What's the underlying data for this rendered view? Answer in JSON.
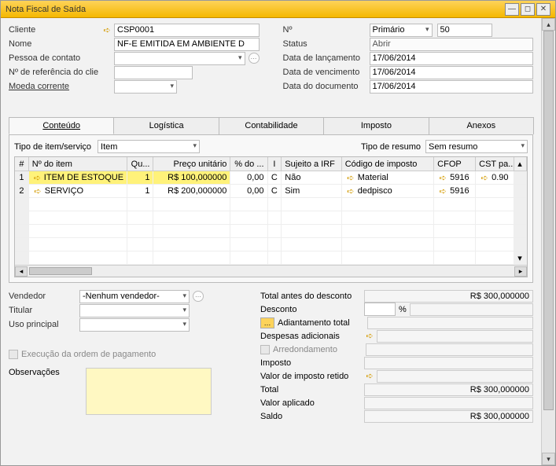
{
  "window": {
    "title": "Nota Fiscal de Saída"
  },
  "left": {
    "cliente_label": "Cliente",
    "cliente_value": "CSP0001",
    "nome_label": "Nome",
    "nome_value": "NF-E EMITIDA EM AMBIENTE D",
    "contato_label": "Pessoa de contato",
    "contato_value": "",
    "ref_label": "Nº de referência do clie",
    "ref_value": "",
    "moeda_label": "Moeda corrente",
    "moeda_value": ""
  },
  "rightf": {
    "no_label": "Nº",
    "no_type": "Primário",
    "no_value": "50",
    "status_label": "Status",
    "status_value": "Abrir",
    "lanc_label": "Data de lançamento",
    "lanc_value": "17/06/2014",
    "venc_label": "Data de vencimento",
    "venc_value": "17/06/2014",
    "doc_label": "Data do documento",
    "doc_value": "17/06/2014"
  },
  "tabs": {
    "t0": "Conteúdo",
    "t1": "Logística",
    "t2": "Contabilidade",
    "t3": "Imposto",
    "t4": "Anexos"
  },
  "sub": {
    "tipo_label": "Tipo de item/serviço",
    "tipo_value": "Item",
    "resumo_label": "Tipo de resumo",
    "resumo_value": "Sem resumo"
  },
  "grid": {
    "h0": "#",
    "h1": "Nº do item",
    "h2": "Qu...",
    "h3": "Preço unitário",
    "h4": "% do ...",
    "h5": "I",
    "h6": "Sujeito a IRF",
    "h7": "Código de imposto",
    "h8": "CFOP",
    "h9": "CST pa...",
    "rows": [
      {
        "n": "1",
        "item": "ITEM DE ESTOQUE",
        "q": "1",
        "price": "R$ 100,000000",
        "pct": "0,00",
        "i": "C",
        "irf": "Não",
        "tax": "Material",
        "cfop": "5916",
        "cst": "0.90"
      },
      {
        "n": "2",
        "item": "SERVIÇO",
        "q": "1",
        "price": "R$ 200,000000",
        "pct": "0,00",
        "i": "C",
        "irf": "Sim",
        "tax": "dedpisco",
        "cfop": "5916",
        "cst": ""
      }
    ]
  },
  "bottomLeft": {
    "vend_label": "Vendedor",
    "vend_value": "-Nenhum vendedor-",
    "titular_label": "Titular",
    "uso_label": "Uso principal",
    "exec_label": "Execução da ordem de pagamento",
    "obs_label": "Observações"
  },
  "totals": {
    "t1_l": "Total antes do desconto",
    "t1_v": "R$ 300,000000",
    "t2_l": "Desconto",
    "t2_pct": "%",
    "t3_l": "Adiantamento total",
    "t4_l": "Despesas adicionais",
    "t5_l": "Arredondamento",
    "t6_l": "Imposto",
    "t7_l": "Valor de imposto retido",
    "t8_l": "Total",
    "t8_v": "R$ 300,000000",
    "t9_l": "Valor aplicado",
    "t10_l": "Saldo",
    "t10_v": "R$ 300,000000"
  }
}
